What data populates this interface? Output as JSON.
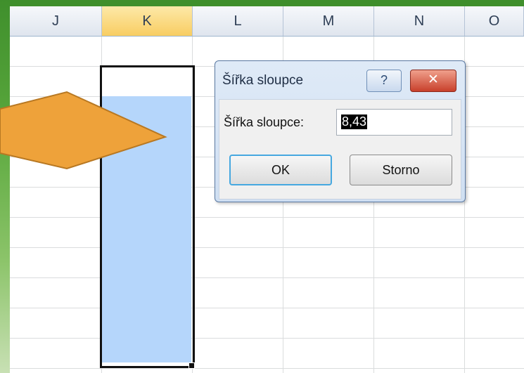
{
  "columns": [
    "J",
    "K",
    "L",
    "M",
    "N",
    "O"
  ],
  "selected_column": "K",
  "colors": {
    "selection_fill": "#b5d6fb",
    "header_selected": "#f8cd62",
    "arrow": "#eea23a",
    "close_button": "#c8402b",
    "window_green": "#3f8f2c"
  },
  "dialog": {
    "title": "Šířka sloupce",
    "help_label": "?",
    "close_label": "✕",
    "field_label": "Šířka sloupce:",
    "field_value": "8,43",
    "ok_label": "OK",
    "cancel_label": "Storno"
  },
  "icons": [
    "help-icon",
    "close-icon",
    "pointer-arrow"
  ]
}
